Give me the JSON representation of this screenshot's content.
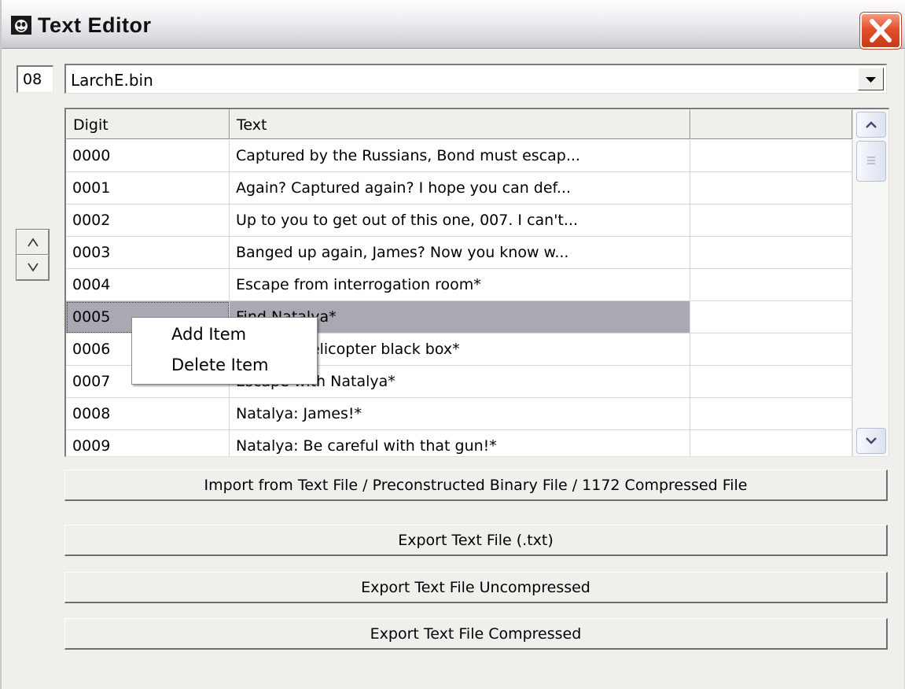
{
  "window": {
    "title": "Text Editor",
    "app_icon": "app-icon",
    "close_icon": "close-icon"
  },
  "index_box": {
    "value": "08"
  },
  "file_combo": {
    "value": "LarchE.bin",
    "dropdown_icon": "chevron-down-icon"
  },
  "reorder": {
    "up_label": "^",
    "down_label": "v"
  },
  "table": {
    "columns": [
      "Digit",
      "Text",
      ""
    ],
    "rows": [
      {
        "digit": "0000",
        "text": "Captured by the Russians, Bond must escap...",
        "extra": ""
      },
      {
        "digit": "0001",
        "text": "Again? Captured again? I hope you can def...",
        "extra": ""
      },
      {
        "digit": "0002",
        "text": "Up to you to get out of this one, 007. I can't...",
        "extra": ""
      },
      {
        "digit": "0003",
        "text": "Banged up again, James? Now you know w...",
        "extra": ""
      },
      {
        "digit": "0004",
        "text": "Escape from interrogation room*",
        "extra": ""
      },
      {
        "digit": "0005",
        "text": "Find Natalya*",
        "extra": "",
        "selected": true
      },
      {
        "digit": "0006",
        "text": "Recover helicopter black box*",
        "extra": ""
      },
      {
        "digit": "0007",
        "text": "Escape with Natalya*",
        "extra": ""
      },
      {
        "digit": "0008",
        "text": "Natalya: James!*",
        "extra": ""
      },
      {
        "digit": "0009",
        "text": "Natalya: Be careful with that gun!*",
        "extra": ""
      }
    ]
  },
  "scrollbar": {
    "up_icon": "scroll-up-icon",
    "down_icon": "scroll-down-icon",
    "grip_icon": "grip-icon"
  },
  "context_menu": {
    "items": [
      "Add Item",
      "Delete Item"
    ]
  },
  "buttons": {
    "import": "Import from Text File / Preconstructed Binary File / 1172 Compressed File",
    "export_txt": "Export Text File (.txt)",
    "export_uncompressed": "Export Text File Uncompressed",
    "export_compressed": "Export Text File Compressed"
  }
}
